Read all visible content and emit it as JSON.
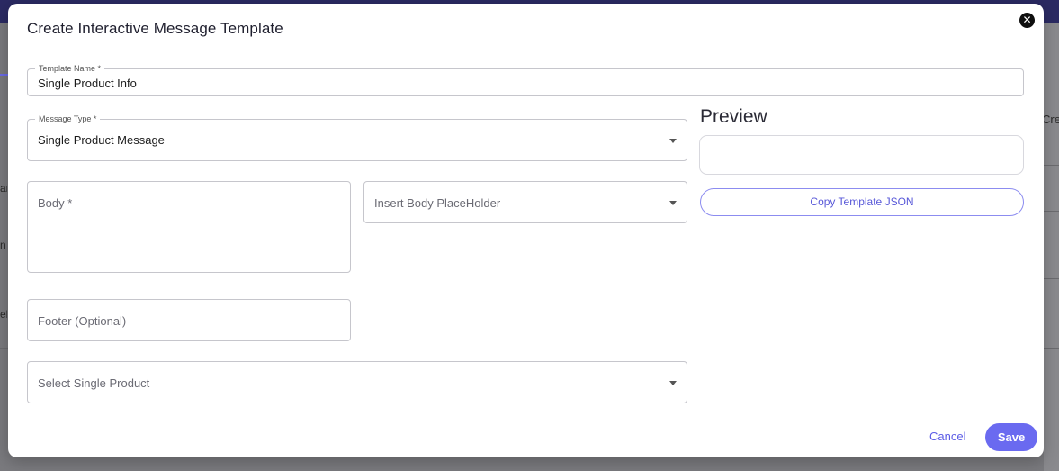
{
  "background": {
    "right_peek": "Cre",
    "left_peeks": [
      "ar",
      "n",
      "el"
    ]
  },
  "modal": {
    "title": "Create Interactive Message Template",
    "close_icon": "close-icon"
  },
  "form": {
    "template_name": {
      "label": "Template Name *",
      "value": "Single Product Info"
    },
    "message_type": {
      "label": "Message Type *",
      "value": "Single Product Message"
    },
    "body": {
      "placeholder": "Body *"
    },
    "insert_placeholder": {
      "placeholder": "Insert Body PlaceHolder"
    },
    "footer": {
      "placeholder": "Footer (Optional)"
    },
    "single_product": {
      "placeholder": "Select Single Product"
    }
  },
  "preview": {
    "title": "Preview",
    "copy_button": "Copy Template JSON"
  },
  "actions": {
    "cancel": "Cancel",
    "save": "Save"
  },
  "colors": {
    "accent": "#6a6af0",
    "link": "#5c5ce6",
    "topbar": "#2b2a63"
  }
}
